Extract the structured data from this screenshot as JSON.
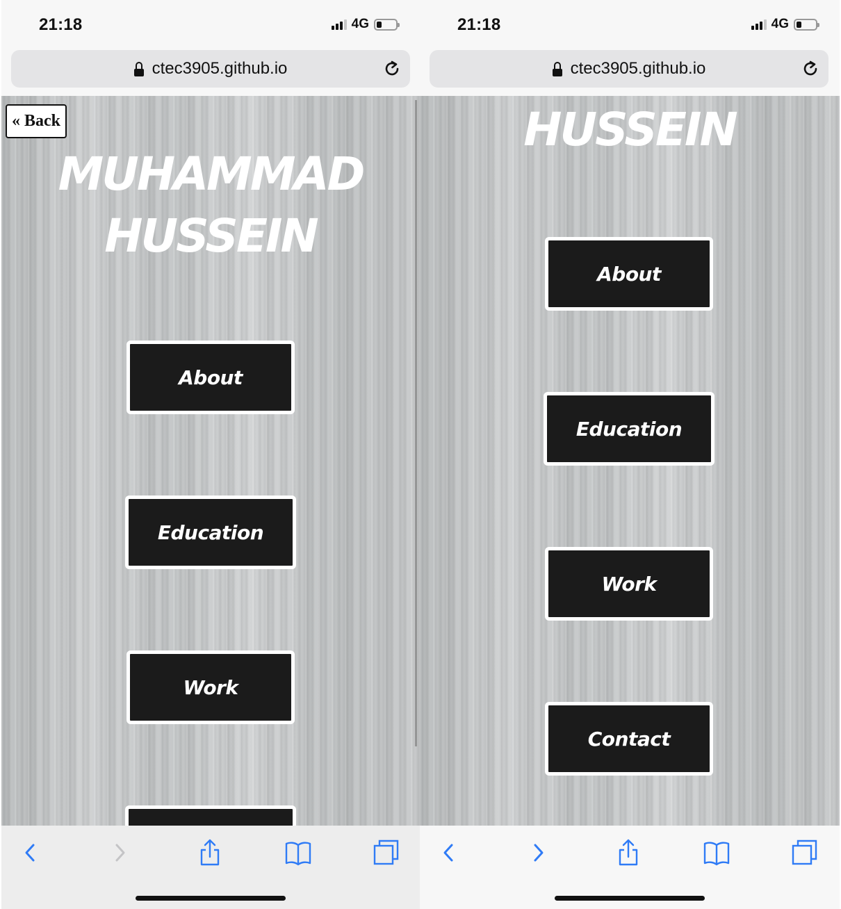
{
  "screens": [
    {
      "status": {
        "time": "21:18",
        "network": "4G"
      },
      "url": "ctec3905.github.io",
      "back_label": "« Back",
      "title_lines": [
        "MUHAMMAD",
        "HUSSEIN"
      ],
      "nav": [
        "About",
        "Education",
        "Work"
      ],
      "toolbar": {
        "icons": [
          "back-chevron-icon",
          "forward-chevron-icon",
          "share-icon",
          "bookmarks-icon",
          "tabs-icon"
        ],
        "forward_enabled": false
      }
    },
    {
      "status": {
        "time": "21:18",
        "network": "4G"
      },
      "url": "ctec3905.github.io",
      "title_lines": [
        "HUSSEIN"
      ],
      "nav": [
        "About",
        "Education",
        "Work",
        "Contact"
      ],
      "toolbar": {
        "icons": [
          "back-chevron-icon",
          "forward-chevron-icon",
          "share-icon",
          "bookmarks-icon",
          "tabs-icon"
        ],
        "forward_enabled": true
      }
    }
  ],
  "colors": {
    "accent_blue": "#2f7bf6",
    "button_bg": "#1b1b1b",
    "button_border": "#ffffff",
    "title_color": "#ffffff"
  }
}
